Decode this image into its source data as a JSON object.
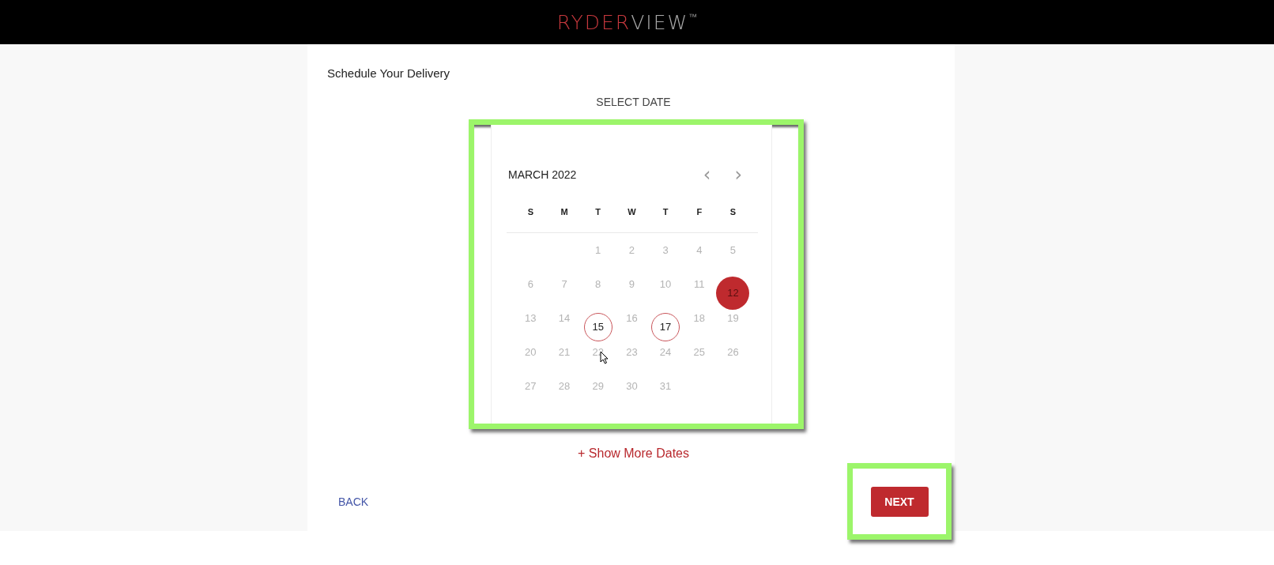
{
  "header": {
    "logo": {
      "primary": "RYDER",
      "secondary": "VIEW",
      "mark": "™"
    }
  },
  "page": {
    "title": "Schedule Your Delivery",
    "subtitle": "SELECT DATE"
  },
  "calendar": {
    "month": "MARCH 2022",
    "prev": "‹",
    "next": "›",
    "weekdays": [
      "S",
      "M",
      "T",
      "W",
      "T",
      "F",
      "S"
    ],
    "weeks": [
      {
        "days": [
          {
            "kind": "blank"
          },
          {
            "kind": "blank"
          },
          {
            "kind": "day",
            "label": "1",
            "available": false,
            "selected": false
          },
          {
            "kind": "day",
            "label": "2",
            "available": false,
            "selected": false
          },
          {
            "kind": "day",
            "label": "3",
            "available": false,
            "selected": false
          },
          {
            "kind": "day",
            "label": "4",
            "available": false,
            "selected": false
          },
          {
            "kind": "day",
            "label": "5",
            "available": false,
            "selected": false
          }
        ]
      },
      {
        "days": [
          {
            "kind": "day",
            "label": "6",
            "available": false,
            "selected": false
          },
          {
            "kind": "day",
            "label": "7",
            "available": false,
            "selected": false
          },
          {
            "kind": "day",
            "label": "8",
            "available": false,
            "selected": false
          },
          {
            "kind": "day",
            "label": "9",
            "available": false,
            "selected": false
          },
          {
            "kind": "day",
            "label": "10",
            "available": false,
            "selected": false
          },
          {
            "kind": "day",
            "label": "11",
            "available": false,
            "selected": false
          },
          {
            "kind": "day",
            "label": "12",
            "available": true,
            "selected": true
          }
        ]
      },
      {
        "days": [
          {
            "kind": "day",
            "label": "13",
            "available": false,
            "selected": false
          },
          {
            "kind": "day",
            "label": "14",
            "available": false,
            "selected": false
          },
          {
            "kind": "day",
            "label": "15",
            "available": true,
            "selected": false
          },
          {
            "kind": "day",
            "label": "16",
            "available": false,
            "selected": false
          },
          {
            "kind": "day",
            "label": "17",
            "available": true,
            "selected": false
          },
          {
            "kind": "day",
            "label": "18",
            "available": false,
            "selected": false
          },
          {
            "kind": "day",
            "label": "19",
            "available": false,
            "selected": false
          }
        ]
      },
      {
        "days": [
          {
            "kind": "day",
            "label": "20",
            "available": false,
            "selected": false
          },
          {
            "kind": "day",
            "label": "21",
            "available": false,
            "selected": false
          },
          {
            "kind": "day",
            "label": "22",
            "available": false,
            "selected": false,
            "hovered": true
          },
          {
            "kind": "day",
            "label": "23",
            "available": false,
            "selected": false
          },
          {
            "kind": "day",
            "label": "24",
            "available": false,
            "selected": false
          },
          {
            "kind": "day",
            "label": "25",
            "available": false,
            "selected": false
          },
          {
            "kind": "day",
            "label": "26",
            "available": false,
            "selected": false
          }
        ]
      },
      {
        "days": [
          {
            "kind": "day",
            "label": "27",
            "available": false,
            "selected": false
          },
          {
            "kind": "day",
            "label": "28",
            "available": false,
            "selected": false
          },
          {
            "kind": "day",
            "label": "29",
            "available": false,
            "selected": false
          },
          {
            "kind": "day",
            "label": "30",
            "available": false,
            "selected": false
          },
          {
            "kind": "day",
            "label": "31",
            "available": false,
            "selected": false
          }
        ]
      }
    ]
  },
  "show_more": "+ Show More Dates",
  "buttons": {
    "back": "BACK",
    "next": "NEXT"
  }
}
